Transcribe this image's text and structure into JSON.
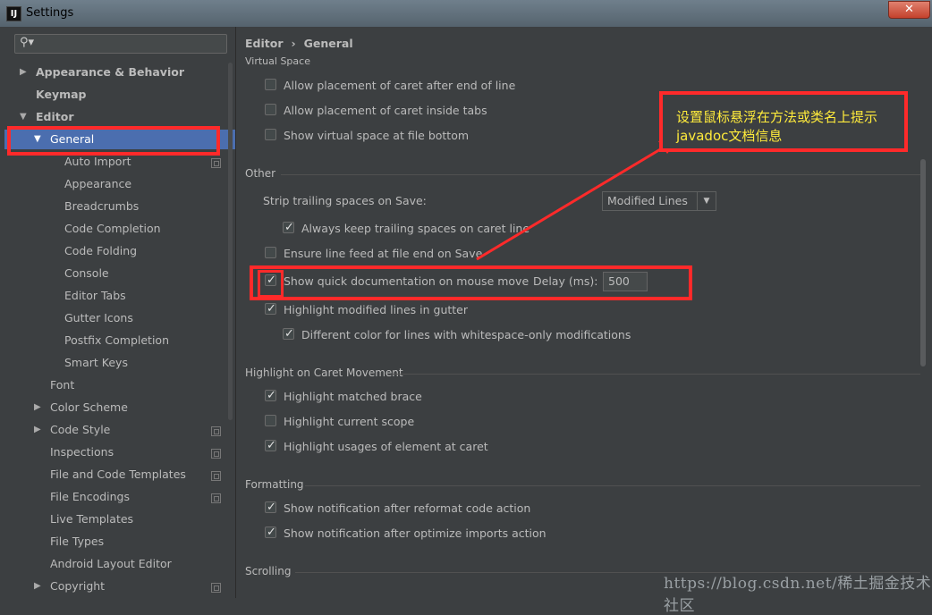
{
  "window": {
    "title": "Settings",
    "close_label": "✕",
    "app_icon_label": "IJ"
  },
  "search": {
    "placeholder": ""
  },
  "breadcrumb": {
    "parent": "Editor",
    "current": "General",
    "separator": "›"
  },
  "tree": {
    "appearance_behavior": "Appearance & Behavior",
    "keymap": "Keymap",
    "editor": "Editor",
    "general": "General",
    "auto_import": "Auto Import",
    "appearance": "Appearance",
    "breadcrumbs": "Breadcrumbs",
    "code_completion": "Code Completion",
    "code_folding": "Code Folding",
    "console": "Console",
    "editor_tabs": "Editor Tabs",
    "gutter_icons": "Gutter Icons",
    "postfix_completion": "Postfix Completion",
    "smart_keys": "Smart Keys",
    "font": "Font",
    "color_scheme": "Color Scheme",
    "code_style": "Code Style",
    "inspections": "Inspections",
    "file_code_templates": "File and Code Templates",
    "file_encodings": "File Encodings",
    "live_templates": "Live Templates",
    "file_types": "File Types",
    "android_layout_editor": "Android Layout Editor",
    "copyright": "Copyright"
  },
  "virtual_space": {
    "title": "Virtual Space",
    "caret_after_end": "Allow placement of caret after end of line",
    "caret_inside_tabs": "Allow placement of caret inside tabs",
    "virtual_space_bottom": "Show virtual space at file bottom"
  },
  "other": {
    "title": "Other",
    "strip_label": "Strip trailing spaces on Save:",
    "strip_value": "Modified Lines",
    "keep_trailing": "Always keep trailing spaces on caret line",
    "ensure_line_feed": "Ensure line feed at file end on Save",
    "quick_doc": "Show quick documentation on mouse move",
    "delay_label": "Delay (ms):",
    "delay_value": "500",
    "highlight_modified": "Highlight modified lines in gutter",
    "different_color": "Different color for lines with whitespace-only modifications"
  },
  "caret_movement": {
    "title": "Highlight on Caret Movement",
    "matched_brace": "Highlight matched brace",
    "current_scope": "Highlight current scope",
    "usages": "Highlight usages of element at caret"
  },
  "formatting": {
    "title": "Formatting",
    "reformat_notify": "Show notification after reformat code action",
    "optimize_notify": "Show notification after optimize imports action"
  },
  "scrolling": {
    "title": "Scrolling"
  },
  "annotation": {
    "line1": "设置鼠标悬浮在方法或类名上提示",
    "line2": "javadoc文档信息"
  },
  "watermark": "https://blog.csdn.net/稀土掘金技术社区",
  "colors": {
    "annotation_red": "#ff2a2a",
    "annotation_text": "#ffeb3b",
    "selection": "#4b6eaf"
  }
}
